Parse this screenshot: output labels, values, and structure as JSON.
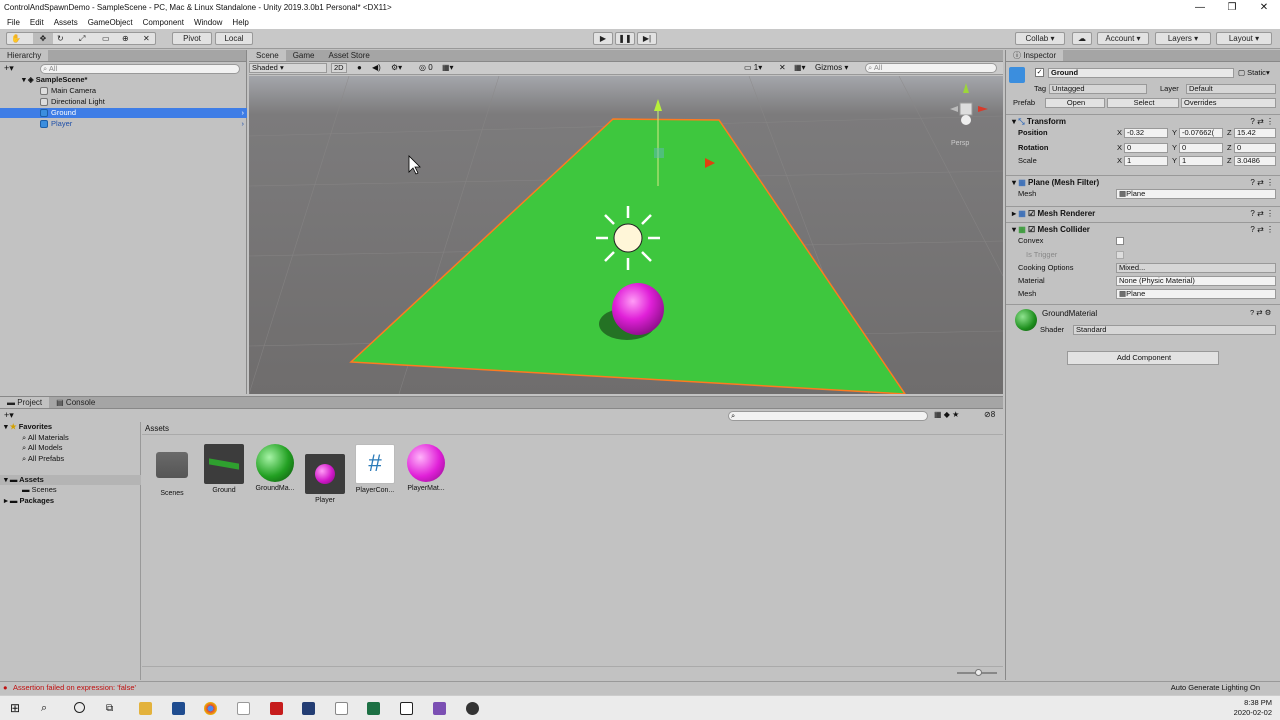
{
  "window": {
    "title": "ControlAndSpawnDemo - SampleScene - PC, Mac & Linux Standalone - Unity 2019.3.0b1 Personal* <DX11>",
    "minimize": "—",
    "maximize": "❐",
    "close": "✕"
  },
  "menu": [
    "File",
    "Edit",
    "Assets",
    "GameObject",
    "Component",
    "Window",
    "Help"
  ],
  "toolbar": {
    "pivot": "Pivot",
    "local": "Local",
    "collab": "Collab",
    "account": "Account",
    "layers": "Layers",
    "layout": "Layout"
  },
  "hierarchy": {
    "tab": "Hierarchy",
    "search_placeholder": "All",
    "scene": "SampleScene*",
    "items": [
      "Main Camera",
      "Directional Light",
      "Ground",
      "Player"
    ]
  },
  "scene_view": {
    "tabs": [
      "Scene",
      "Game",
      "Asset Store"
    ],
    "shading": "Shaded",
    "mode": "2D",
    "gizmos": "Gizmos",
    "search_placeholder": "All",
    "persp": "Persp",
    "count_1": "0",
    "count_2": "1"
  },
  "inspector": {
    "tab": "Inspector",
    "object_name": "Ground",
    "static_label": "Static",
    "tag_label": "Tag",
    "tag": "Untagged",
    "layer_label": "Layer",
    "layer": "Default",
    "prefab_label": "Prefab",
    "open": "Open",
    "select": "Select",
    "overrides": "Overrides",
    "transform": {
      "title": "Transform",
      "position_label": "Position",
      "rotation_label": "Rotation",
      "scale_label": "Scale",
      "position": {
        "x": "-0.32",
        "y": "-0.07662(",
        "z": "15.42"
      },
      "rotation": {
        "x": "0",
        "y": "0",
        "z": "0"
      },
      "scale": {
        "x": "1",
        "y": "1",
        "z": "3.0486"
      }
    },
    "mesh_filter": {
      "title": "Plane (Mesh Filter)",
      "mesh_label": "Mesh",
      "mesh": "Plane"
    },
    "mesh_renderer": {
      "title": "Mesh Renderer"
    },
    "mesh_collider": {
      "title": "Mesh Collider",
      "convex": "Convex",
      "is_trigger": "Is Trigger",
      "cooking_label": "Cooking Options",
      "cooking": "Mixed...",
      "material_label": "Material",
      "material": "None (Physic Material)",
      "mesh_label": "Mesh",
      "mesh": "Plane"
    },
    "material": {
      "name": "GroundMaterial",
      "shader_label": "Shader",
      "shader": "Standard"
    },
    "add_component": "Add Component"
  },
  "project": {
    "tabs": [
      "Project",
      "Console"
    ],
    "count": "8",
    "favorites": {
      "title": "Favorites",
      "items": [
        "All Materials",
        "All Models",
        "All Prefabs"
      ]
    },
    "tree": {
      "assets": "Assets",
      "scenes": "Scenes",
      "packages": "Packages"
    },
    "breadcrumb": "Assets",
    "assets": [
      {
        "name": "Scenes",
        "kind": "folder"
      },
      {
        "name": "Ground",
        "kind": "mesh"
      },
      {
        "name": "GroundMa...",
        "kind": "green-ball"
      },
      {
        "name": "Player",
        "kind": "small-pink"
      },
      {
        "name": "PlayerCon...",
        "kind": "script"
      },
      {
        "name": "PlayerMat...",
        "kind": "pink-ball"
      }
    ]
  },
  "status": {
    "error": "Assertion failed on expression: 'false'",
    "right": "Auto Generate Lighting On"
  },
  "clock": {
    "time": "8:38 PM",
    "date": "2020-02-02"
  },
  "colors": {
    "selection": "#3e7de6",
    "ground": "#3ec73e",
    "player": "#e020d8",
    "sky": "#8a8a8e"
  }
}
